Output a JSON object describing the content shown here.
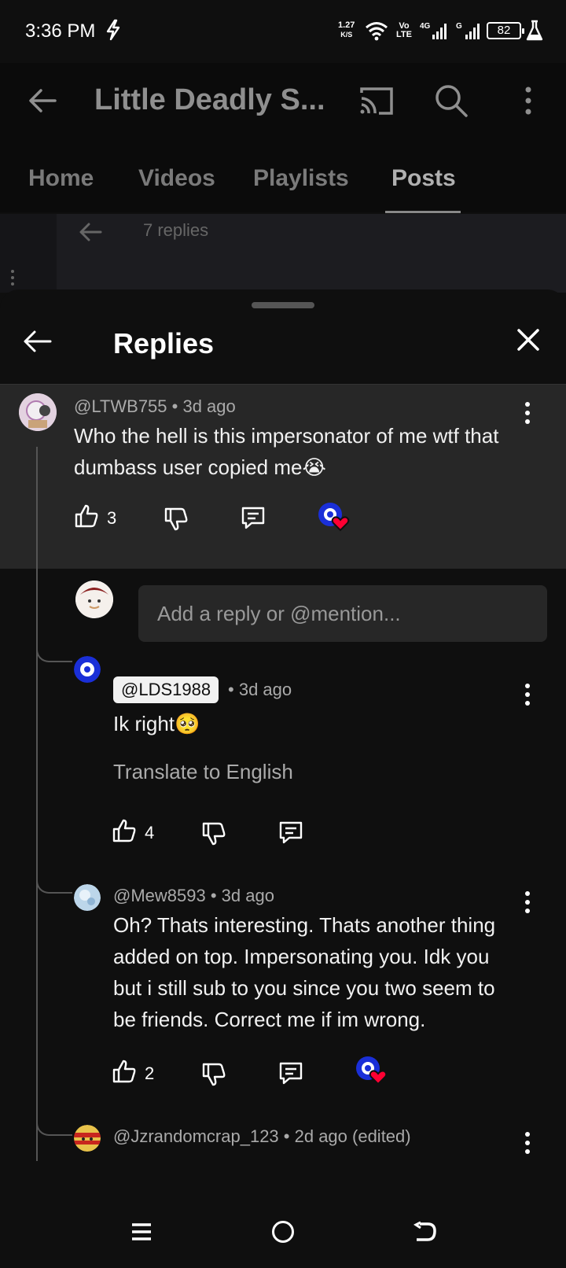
{
  "status_bar": {
    "time": "3:36 PM",
    "speed_value": "1.27",
    "speed_unit": "K/S",
    "volte_top": "Vo",
    "volte_bottom": "LTE",
    "net1": "4G",
    "net2": "G",
    "battery": "82"
  },
  "header": {
    "title": "Little Deadly S...",
    "tabs": [
      {
        "label": "Home",
        "active": false
      },
      {
        "label": "Videos",
        "active": false
      },
      {
        "label": "Playlists",
        "active": false
      },
      {
        "label": "Posts",
        "active": true
      }
    ]
  },
  "underlying": {
    "replies_count": "7 replies"
  },
  "sheet": {
    "title": "Replies",
    "parent_comment": {
      "author": "@LTWB755",
      "time": "3d ago",
      "text": "Who the hell is this impersonator of me wtf that dumbass user copied me😭",
      "likes": "3",
      "creator_hearted": true
    },
    "reply_input": {
      "placeholder": "Add a reply or @mention..."
    },
    "replies": [
      {
        "author": "@LDS1988",
        "author_is_chip": true,
        "time": "3d ago",
        "text": "Ik  right🥺",
        "translate": "Translate to English",
        "likes": "4",
        "creator_hearted": false
      },
      {
        "author": "@Mew8593",
        "time": "3d ago",
        "text": "Oh? Thats interesting. Thats another thing added on top. Impersonating you. Idk you but i still sub to you since you two seem to be friends. Correct me if im wrong.",
        "likes": "2",
        "creator_hearted": true
      },
      {
        "author": "@Jzrandomcrap_123",
        "time": "2d ago (edited)"
      }
    ]
  },
  "colors": {
    "background": "#0f0f0f",
    "parent_highlight": "#272727",
    "heart": "#ff0033",
    "creator_blue": "#1a2fd8"
  }
}
